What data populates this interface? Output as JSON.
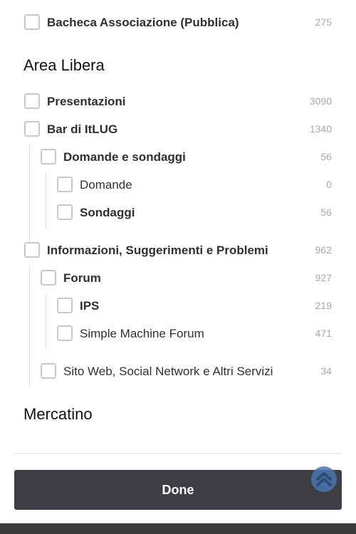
{
  "forums": {
    "bacheca": {
      "label": "Bacheca Associazione (Pubblica)",
      "count": "275"
    },
    "section_area_libera": "Area Libera",
    "presentazioni": {
      "label": "Presentazioni",
      "count": "3090"
    },
    "bar": {
      "label": "Bar di ItLUG",
      "count": "1340"
    },
    "domande_sondaggi": {
      "label": "Domande e sondaggi",
      "count": "56"
    },
    "domande": {
      "label": "Domande",
      "count": "0"
    },
    "sondaggi": {
      "label": "Sondaggi",
      "count": "56"
    },
    "informazioni": {
      "label": "Informazioni, Suggerimenti e Problemi",
      "count": "962"
    },
    "forum": {
      "label": "Forum",
      "count": "927"
    },
    "ips": {
      "label": "IPS",
      "count": "219"
    },
    "smf": {
      "label": "Simple Machine Forum",
      "count": "471"
    },
    "sito": {
      "label": "Sito Web, Social Network e Altri Servizi",
      "count": "34"
    },
    "section_mercatino": "Mercatino"
  },
  "footer": {
    "done_label": "Done"
  },
  "icons": {
    "checkbox": "checkbox-empty",
    "scroll_top": "chevron-up-icon"
  },
  "colors": {
    "done_bg": "#3d3f45",
    "scroll_top_bg": "#4a76b0"
  }
}
